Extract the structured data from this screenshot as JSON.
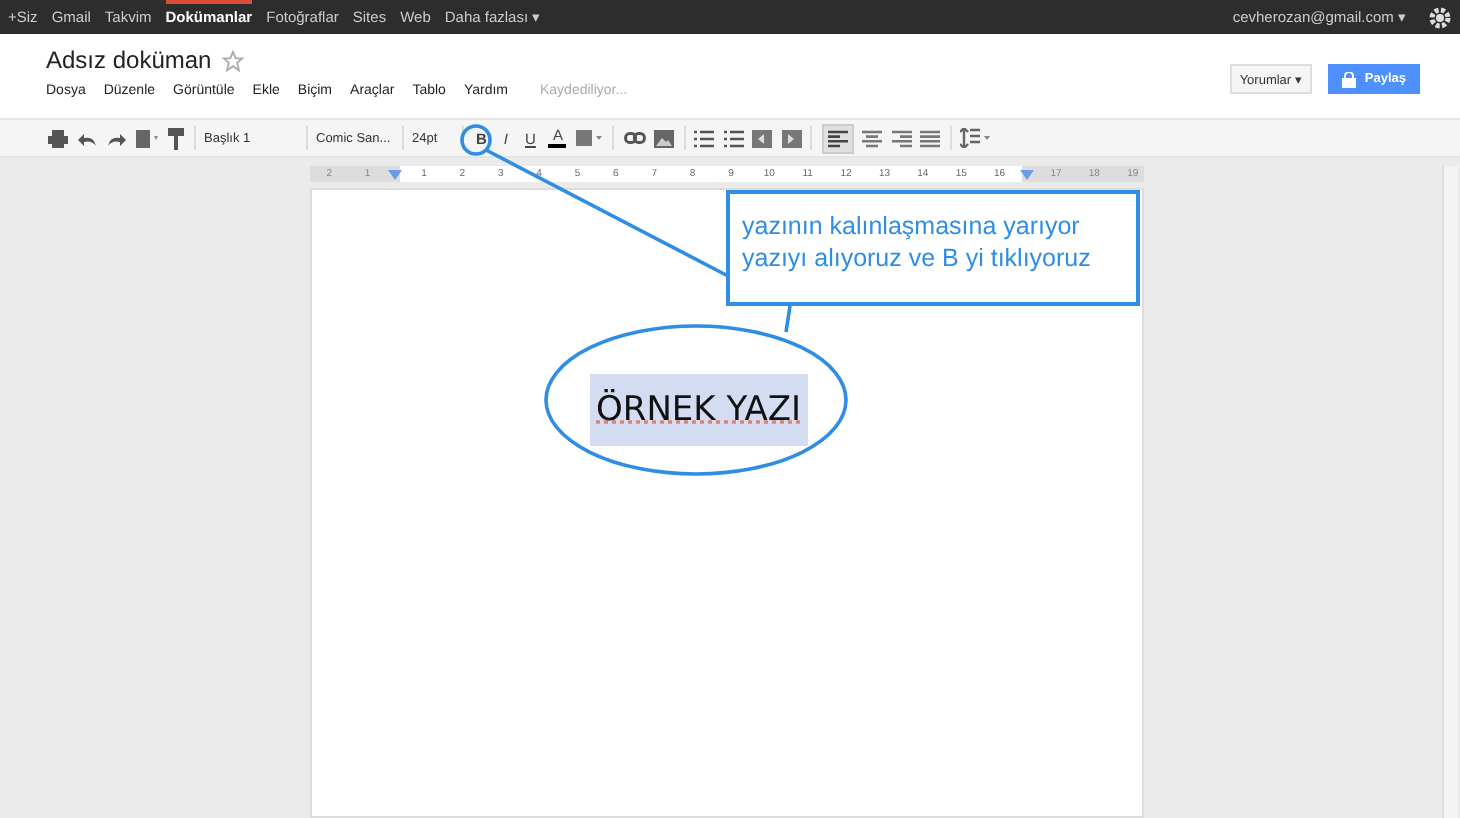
{
  "topbar": {
    "links": [
      {
        "label": "+Siz",
        "selected": false
      },
      {
        "label": "Gmail",
        "selected": false
      },
      {
        "label": "Takvim",
        "selected": false
      },
      {
        "label": "Dokümanlar",
        "selected": true
      },
      {
        "label": "Fotoğraflar",
        "selected": false
      },
      {
        "label": "Sites",
        "selected": false
      },
      {
        "label": "Web",
        "selected": false
      },
      {
        "label": "Daha fazlası ▾",
        "selected": false
      }
    ],
    "account": "cevherozan@gmail.com ▾"
  },
  "document": {
    "title": "Adsız doküman",
    "status": "Kaydediliyor...",
    "comments_button": "Yorumlar ▾",
    "share_button": "Paylaş"
  },
  "menu": [
    "Dosya",
    "Düzenle",
    "Görüntüle",
    "Ekle",
    "Biçim",
    "Araçlar",
    "Tablo",
    "Yardım"
  ],
  "toolbar": {
    "style": "Başlık 1",
    "font": "Comic San...",
    "size": "24pt",
    "bold": "B",
    "italic": "I",
    "underline": "U",
    "text_color": "A"
  },
  "ruler": [
    "2",
    "1",
    "1",
    "2",
    "3",
    "4",
    "5",
    "6",
    "7",
    "8",
    "9",
    "10",
    "11",
    "12",
    "13",
    "14",
    "15",
    "16",
    "17",
    "18",
    "19"
  ],
  "page": {
    "text": "ÖRNEK YAZI",
    "selected": true
  },
  "annotation": {
    "lines": [
      "yazının kalınlaşmasına yarıyor",
      "yazıyı alıyoruz ve B yi tıklıyoruz"
    ]
  }
}
